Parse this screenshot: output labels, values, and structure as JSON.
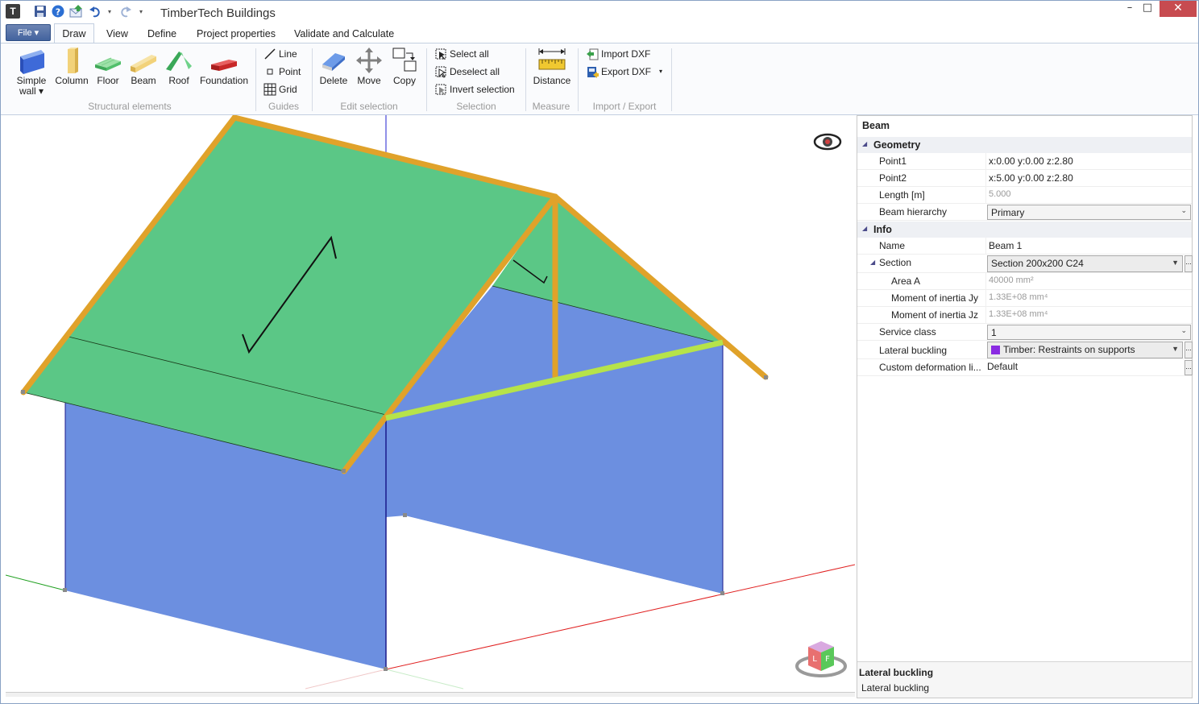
{
  "window": {
    "title": "TimberTech Buildings",
    "app_icon_letter": "T",
    "minimize": "–",
    "maximize": "□",
    "close": "✕"
  },
  "menu": {
    "file": "File ▾",
    "tabs": [
      "Draw",
      "View",
      "Define",
      "Project properties",
      "Validate and Calculate"
    ]
  },
  "ribbon": {
    "structural": {
      "simple_wall": "Simple",
      "simple_wall_2": "wall ▾",
      "column": "Column",
      "floor": "Floor",
      "beam": "Beam",
      "roof": "Roof",
      "foundation": "Foundation",
      "group": "Structural elements"
    },
    "guides": {
      "line": "Line",
      "point": "Point",
      "grid": "Grid",
      "group": "Guides"
    },
    "edit": {
      "delete": "Delete",
      "move": "Move",
      "copy": "Copy",
      "group": "Edit selection"
    },
    "selection": {
      "select_all": "Select all",
      "deselect_all": "Deselect all",
      "invert": "Invert selection",
      "group": "Selection"
    },
    "measure": {
      "distance": "Distance",
      "group": "Measure"
    },
    "import_export": {
      "import": "Import DXF",
      "export": "Export DXF",
      "export_arrow": "▾",
      "group": "Import / Export"
    }
  },
  "viewport": {
    "cube_left": "L",
    "cube_front": "F"
  },
  "properties": {
    "title": "Beam",
    "categories": {
      "geometry": "Geometry",
      "info": "Info"
    },
    "geometry": [
      {
        "name": "Point1",
        "value": "x:0.00 y:0.00 z:2.80"
      },
      {
        "name": "Point2",
        "value": "x:5.00 y:0.00 z:2.80"
      },
      {
        "name": "Length [m]",
        "value": "5.000"
      },
      {
        "name": "Beam hierarchy",
        "value": "Primary"
      }
    ],
    "info": {
      "name_label": "Name",
      "name_value": "Beam 1",
      "section_label": "Section",
      "section_value": "Section 200x200 C24",
      "area_label": "Area A",
      "area_value": "40000 mm²",
      "jy_label": "Moment of inertia Jy",
      "jy_value": "1.33E+08 mm⁴",
      "jz_label": "Moment of inertia Jz",
      "jz_value": "1.33E+08 mm⁴",
      "service_label": "Service class",
      "service_value": "1",
      "lateral_label": "Lateral buckling",
      "lateral_value": "Timber: Restraints on supports",
      "custom_label": "Custom deformation li...",
      "custom_value": "Default"
    },
    "dots": "...",
    "description": {
      "title": "Lateral buckling",
      "text": "Lateral buckling"
    }
  },
  "colors": {
    "roof": "#5bc786",
    "wall": "#6c8fe0",
    "beam": "#e0a22a",
    "selected_beam": "#b6e34a",
    "axis_x": "#e02020",
    "axis_y": "#20a020",
    "axis_z": "#2020d0"
  }
}
